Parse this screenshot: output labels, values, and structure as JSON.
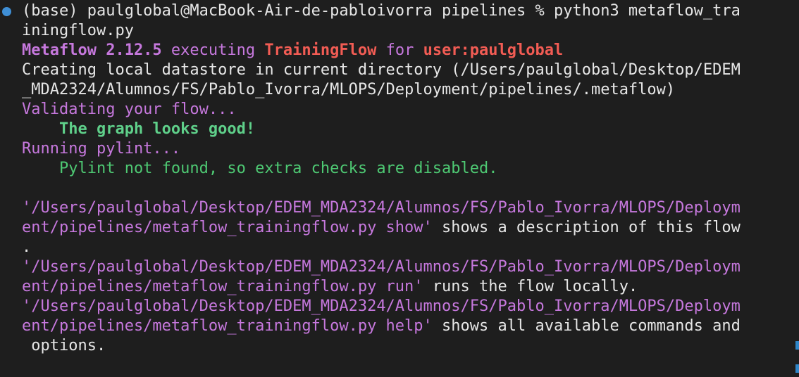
{
  "terminal": {
    "prompt_line_1": "(base) paulglobal@MacBook-Air-de-pabloivorra pipelines % python3 metaflow_tra",
    "prompt_line_2": "iningflow.py",
    "metaflow_name": "Metaflow 2.12.5",
    "executing_word": " executing ",
    "flow_name": "TrainingFlow",
    "for_word": " for ",
    "user_label": "user:paulglobal",
    "datastore_line_1": "Creating local datastore in current directory (/Users/paulglobal/Desktop/EDEM",
    "datastore_line_2": "_MDA2324/Alumnos/FS/Pablo_Ivorra/MLOPS/Deployment/pipelines/.metaflow)",
    "validating": "Validating your flow...",
    "graph_good": "    The graph looks good!",
    "running_pylint": "Running pylint...",
    "pylint_missing": "    Pylint not found, so extra checks are disabled.",
    "show_path_1": "'/Users/paulglobal/Desktop/EDEM_MDA2324/Alumnos/FS/Pablo_Ivorra/MLOPS/Deploym",
    "show_path_2": "ent/pipelines/metaflow_trainingflow.py show'",
    "show_desc": " shows a description of this flow",
    "show_end": ".",
    "run_path_1": "'/Users/paulglobal/Desktop/EDEM_MDA2324/Alumnos/FS/Pablo_Ivorra/MLOPS/Deploym",
    "run_path_2": "ent/pipelines/metaflow_trainingflow.py run'",
    "run_desc": " runs the flow locally.",
    "help_path_1": "'/Users/paulglobal/Desktop/EDEM_MDA2324/Alumnos/FS/Pablo_Ivorra/MLOPS/Deploym",
    "help_path_2": "ent/pipelines/metaflow_trainingflow.py help'",
    "help_desc": " shows all available commands and",
    "help_end": " options."
  },
  "colors": {
    "background": "#1e1e1e",
    "magenta": "#c678dd",
    "red": "#f25c54",
    "green": "#4ec973",
    "white": "#e6e6e6",
    "prompt_dot": "#3f8fd6"
  },
  "icons": {
    "prompt_marker": "circle-dot-icon"
  }
}
